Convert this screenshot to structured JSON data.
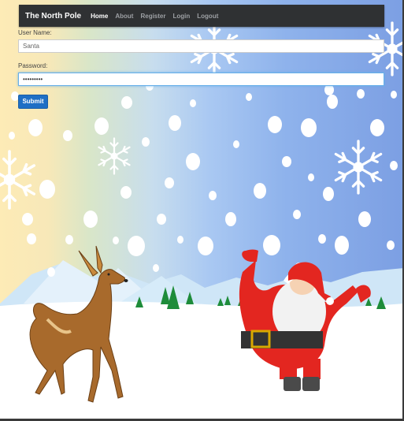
{
  "navbar": {
    "brand": "The North Pole",
    "links": [
      "Home",
      "About",
      "Register",
      "Login",
      "Logout"
    ],
    "active": "Home"
  },
  "form": {
    "username_label": "User Name:",
    "username_value": "Santa",
    "password_label": "Password:",
    "password_value": "•••••••••",
    "submit_label": "Submit"
  },
  "scene": {
    "sky_colors": [
      "#fdebb6",
      "#a9c8f2",
      "#7c9fe3"
    ],
    "snow_color": "#ffffff",
    "tree_color": "#1e8c3a"
  }
}
